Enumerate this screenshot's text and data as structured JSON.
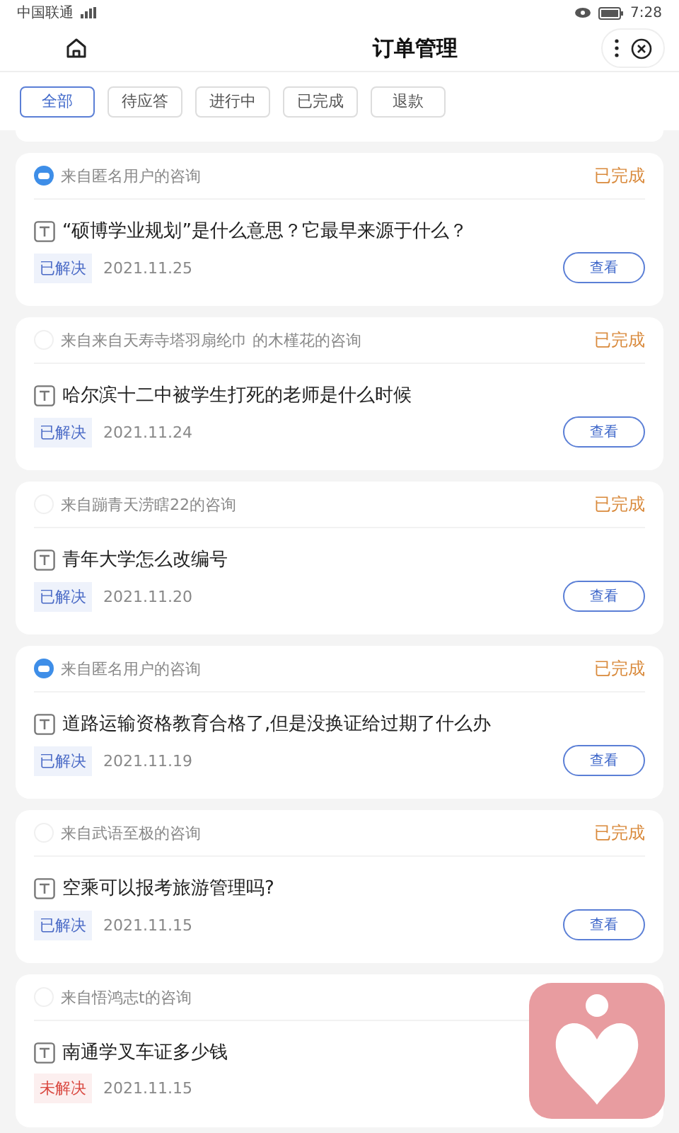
{
  "status_bar": {
    "carrier": "中国联通",
    "time": "7:28"
  },
  "header": {
    "title": "订单管理"
  },
  "filters": [
    {
      "label": "全部",
      "selected": true
    },
    {
      "label": "待应答",
      "selected": false
    },
    {
      "label": "进行中",
      "selected": false
    },
    {
      "label": "已完成",
      "selected": false
    },
    {
      "label": "退款",
      "selected": false
    }
  ],
  "orders": [
    {
      "kind": "anonymous",
      "source": "来自匿名用户的咨询",
      "status": "已完成",
      "question": "“硕博学业规划”是什么意思？它最早来源于什么？",
      "resolution": "已解决",
      "resolved": true,
      "date": "2021.11.25",
      "button": "查看"
    },
    {
      "kind": "blank",
      "source": "来自来自天寿寺塔羽扇纶巾 的木槿花的咨询",
      "status": "已完成",
      "question": "哈尔滨十二中被学生打死的老师是什么时候",
      "resolution": "已解决",
      "resolved": true,
      "date": "2021.11.24",
      "button": "查看"
    },
    {
      "kind": "blank",
      "source": "来自蹦青天涝瞎22的咨询",
      "status": "已完成",
      "question": "青年大学怎么改编号",
      "resolution": "已解决",
      "resolved": true,
      "date": "2021.11.20",
      "button": "查看"
    },
    {
      "kind": "anonymous",
      "source": "来自匿名用户的咨询",
      "status": "已完成",
      "question": "道路运输资格教育合格了,但是没换证给过期了什么办",
      "resolution": "已解决",
      "resolved": true,
      "date": "2021.11.19",
      "button": "查看"
    },
    {
      "kind": "blank",
      "source": "来自武语至极的咨询",
      "status": "已完成",
      "question": "空乘可以报考旅游管理吗?",
      "resolution": "已解决",
      "resolved": true,
      "date": "2021.11.15",
      "button": "查看"
    },
    {
      "kind": "blank",
      "source": "来自悟鸿志t的咨询",
      "question": "南通学叉车证多少钱",
      "resolution": "未解决",
      "resolved": false,
      "date": "2021.11.15"
    }
  ]
}
